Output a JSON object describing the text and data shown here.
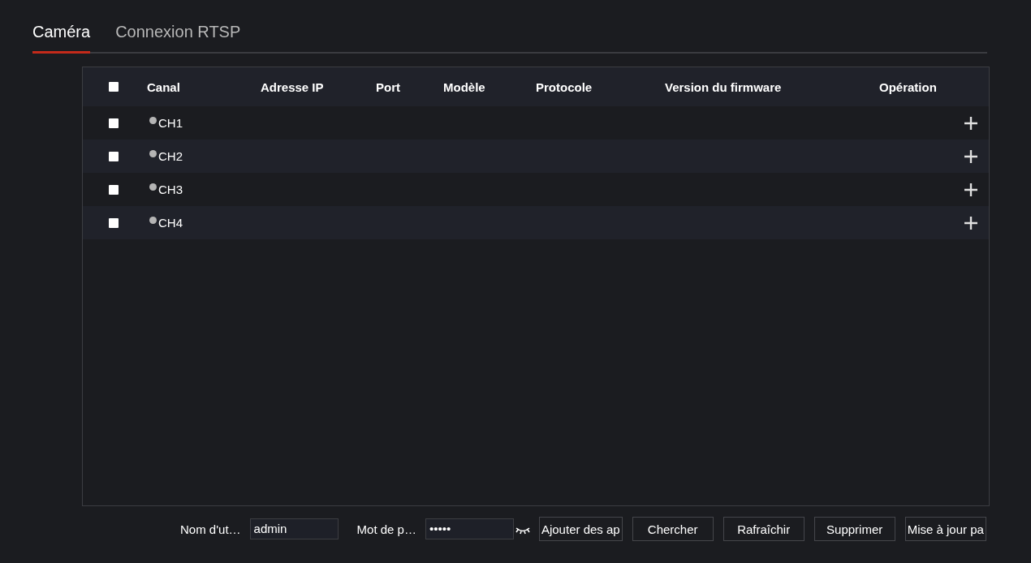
{
  "tabs": [
    {
      "label": "Caméra",
      "selected": true
    },
    {
      "label": "Connexion RTSP",
      "selected": false
    }
  ],
  "table": {
    "select_all": {
      "checked": false
    },
    "columns": [
      "Canal",
      "Adresse IP",
      "Port",
      "Modèle",
      "Protocole",
      "Version du firmware",
      "Opération"
    ],
    "rows": [
      {
        "checked": false,
        "color": "#b4b4b4",
        "channel": "CH1"
      },
      {
        "checked": false,
        "color": "#b4b4b4",
        "channel": "CH2"
      },
      {
        "checked": false,
        "color": "#b4b4b4",
        "channel": "CH3"
      },
      {
        "checked": false,
        "color": "#b4b4b4",
        "channel": "CH4"
      }
    ]
  },
  "footer": {
    "username_label": "Nom d'ut…",
    "username": "admin",
    "password_label": "Mot de p…",
    "password": "•••••",
    "buttons": [
      "Ajouter des ap",
      "Chercher",
      "Rafraîchir",
      "Supprimer",
      "Mise à jour pa"
    ]
  }
}
